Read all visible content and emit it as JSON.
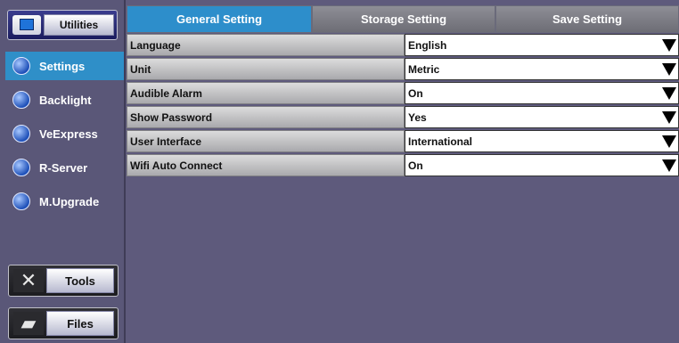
{
  "sidebar": {
    "utilities_label": "Utilities",
    "items": [
      {
        "label": "Settings",
        "icon": "settings-icon",
        "active": true
      },
      {
        "label": "Backlight",
        "icon": "backlight-icon",
        "active": false
      },
      {
        "label": "VeExpress",
        "icon": "veexpress-icon",
        "active": false
      },
      {
        "label": "R-Server",
        "icon": "r-server-icon",
        "active": false
      },
      {
        "label": "M.Upgrade",
        "icon": "upgrade-icon",
        "active": false
      }
    ],
    "tools_label": "Tools",
    "files_label": "Files"
  },
  "tabs": [
    {
      "label": "General Setting",
      "active": true
    },
    {
      "label": "Storage Setting",
      "active": false
    },
    {
      "label": "Save Setting",
      "active": false
    }
  ],
  "settings": [
    {
      "label": "Language",
      "value": "English"
    },
    {
      "label": "Unit",
      "value": "Metric"
    },
    {
      "label": "Audible Alarm",
      "value": "On"
    },
    {
      "label": "Show Password",
      "value": "Yes"
    },
    {
      "label": "User Interface",
      "value": "International"
    },
    {
      "label": "Wifi Auto Connect",
      "value": "On"
    }
  ],
  "colors": {
    "background": "#5e5a7c",
    "active_accent": "#2d8ecb"
  }
}
